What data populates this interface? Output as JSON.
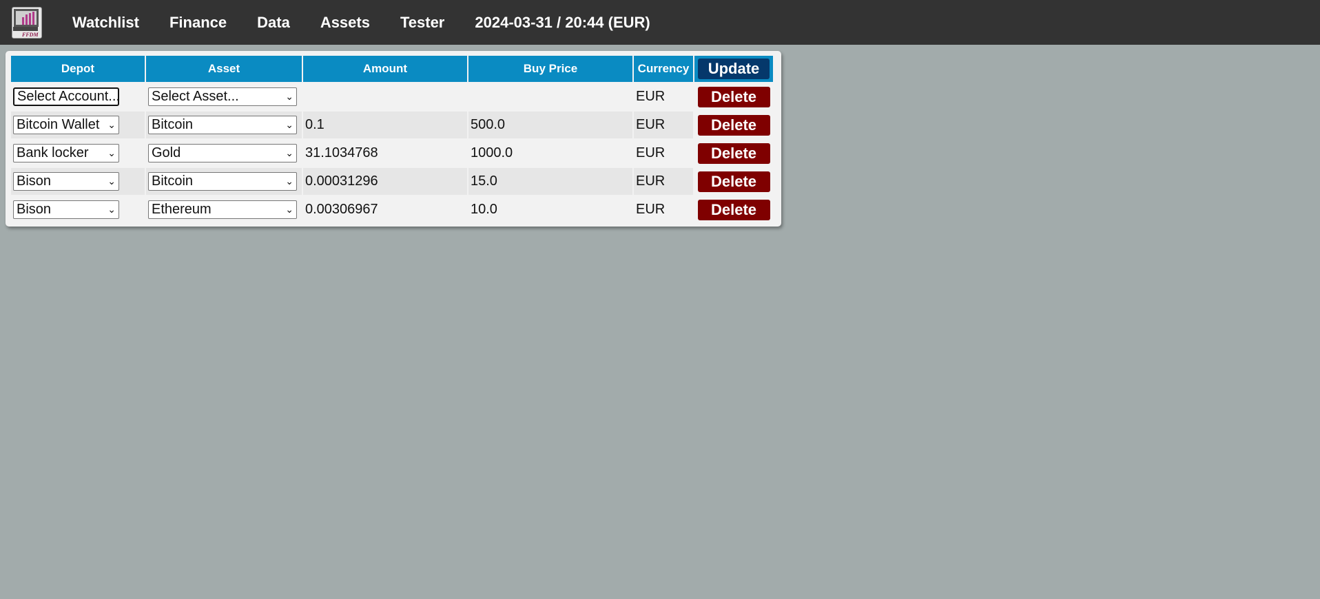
{
  "app": {
    "logo_text": "FFDM",
    "nav": [
      "Watchlist",
      "Finance",
      "Data",
      "Assets",
      "Tester"
    ],
    "status": "2024-03-31 / 20:44 (EUR)"
  },
  "table": {
    "headers": {
      "depot": "Depot",
      "asset": "Asset",
      "amount": "Amount",
      "buy_price": "Buy Price",
      "currency": "Currency",
      "update": "Update"
    },
    "delete_label": "Delete",
    "rows": [
      {
        "depot": "Select Account...",
        "asset": "Select Asset...",
        "amount": "",
        "buy_price": "",
        "currency": "EUR"
      },
      {
        "depot": "Bitcoin Wallet",
        "asset": "Bitcoin",
        "amount": "0.1",
        "buy_price": "500.0",
        "currency": "EUR"
      },
      {
        "depot": "Bank locker",
        "asset": "Gold",
        "amount": "31.1034768",
        "buy_price": "1000.0",
        "currency": "EUR"
      },
      {
        "depot": "Bison",
        "asset": "Bitcoin",
        "amount": "0.00031296",
        "buy_price": "15.0",
        "currency": "EUR"
      },
      {
        "depot": "Bison",
        "asset": "Ethereum",
        "amount": "0.00306967",
        "buy_price": "10.0",
        "currency": "EUR"
      }
    ]
  },
  "colors": {
    "topbar": "#333333",
    "background": "#a2abab",
    "header": "#0a8bc2",
    "update_button": "#05386b",
    "delete_button": "#7f0000"
  },
  "icons": {
    "select_arrow": "chevron-down-icon",
    "logo": "ffdm-logo-icon"
  }
}
